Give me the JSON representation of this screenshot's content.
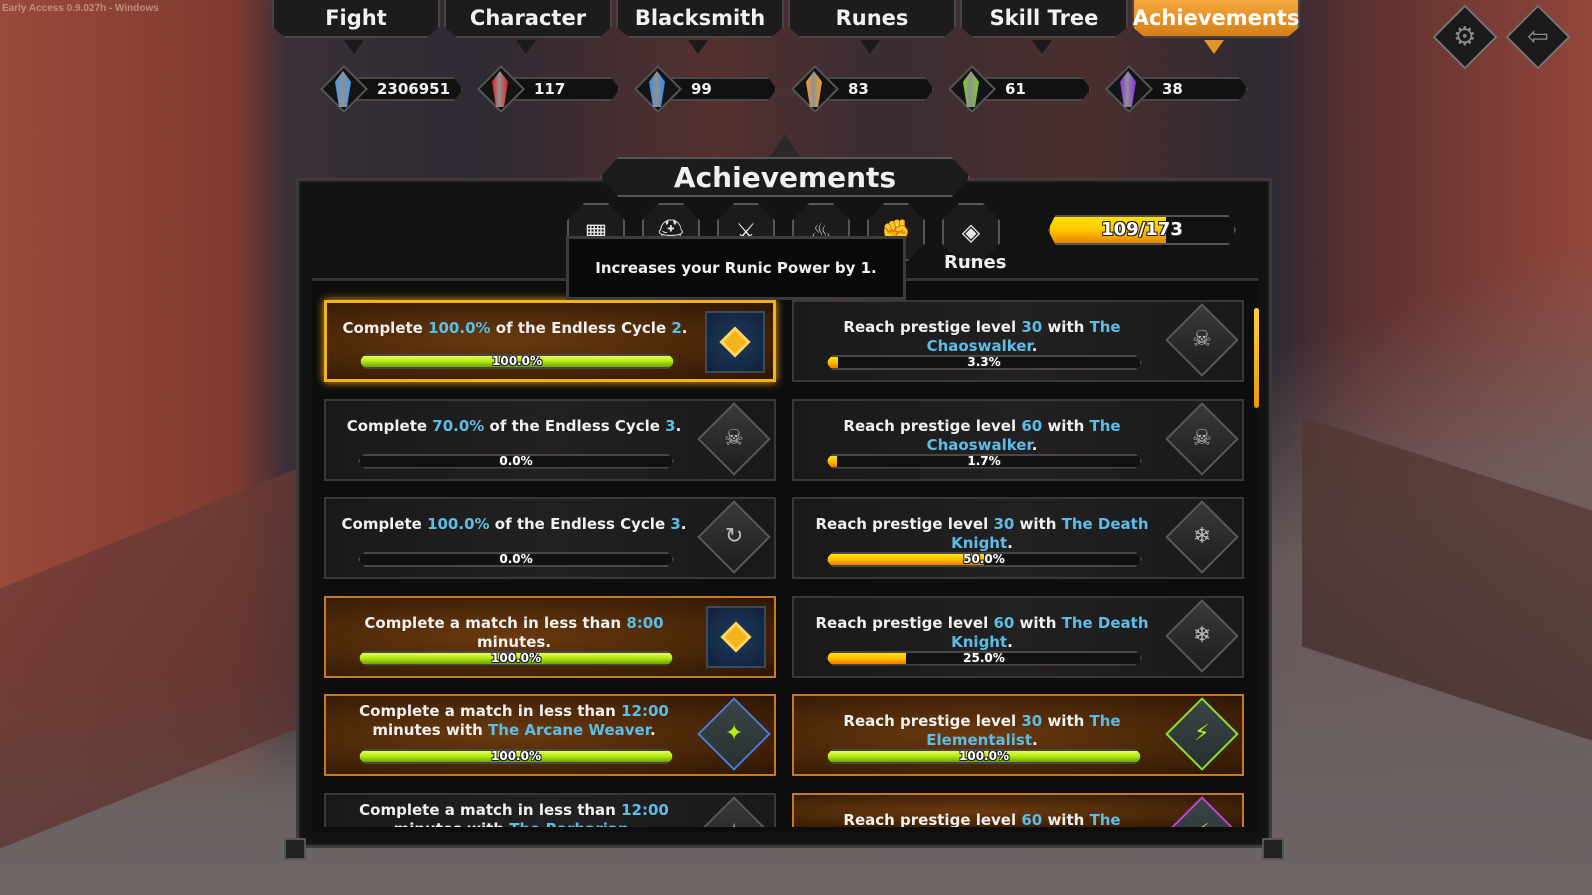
{
  "version_label": "Early Access 0.9.027h - Windows",
  "nav": {
    "tabs": [
      {
        "label": "Fight",
        "active": false
      },
      {
        "label": "Character",
        "active": false
      },
      {
        "label": "Blacksmith",
        "active": false
      },
      {
        "label": "Runes",
        "active": false
      },
      {
        "label": "Skill Tree",
        "active": false
      },
      {
        "label": "Achievements",
        "active": true
      }
    ],
    "settings_icon": "gear-icon",
    "exit_icon": "exit-door-icon"
  },
  "currencies": [
    {
      "name": "blue-crystal",
      "value": "2306951",
      "color": "#3d9cf0"
    },
    {
      "name": "red-gem",
      "value": "117",
      "color": "#e02424"
    },
    {
      "name": "blue-gem",
      "value": "99",
      "color": "#2a8cf0"
    },
    {
      "name": "orange-gem",
      "value": "83",
      "color": "#f5a020"
    },
    {
      "name": "green-gem",
      "value": "61",
      "color": "#7ad21a"
    },
    {
      "name": "purple-gem",
      "value": "38",
      "color": "#8a2cf0"
    }
  ],
  "panel": {
    "title": "Achievements",
    "categories": [
      {
        "icon": "grid-icon",
        "glyph": "▦"
      },
      {
        "icon": "helmet-icon",
        "glyph": "⛑"
      },
      {
        "icon": "sword-icon",
        "glyph": "⚔"
      },
      {
        "icon": "flame-icon",
        "glyph": "♨"
      },
      {
        "icon": "fist-icon",
        "glyph": "✊"
      },
      {
        "icon": "rune-icon",
        "glyph": "◈",
        "label": "Runes",
        "selected": true
      }
    ],
    "total_progress": {
      "text": "109/173",
      "completed": 109,
      "total": 173
    },
    "tooltip": "Increases your Runic Power by 1.",
    "scroll_position": 0.0
  },
  "achievements_left": [
    {
      "parts": [
        "Complete ",
        "100.0%",
        " of the Endless Cycle ",
        "2",
        "."
      ],
      "progress": 100.0,
      "progress_text": "100.0%",
      "done": true,
      "selected": true,
      "icon": "rune-diamond-icon"
    },
    {
      "parts": [
        "Complete ",
        "70.0%",
        " of the Endless Cycle ",
        "3",
        "."
      ],
      "progress": 0.0,
      "progress_text": "0.0%",
      "done": false,
      "icon": "chaos-skull-icon"
    },
    {
      "parts": [
        "Complete ",
        "100.0%",
        " of the Endless Cycle ",
        "3",
        "."
      ],
      "progress": 0.0,
      "progress_text": "0.0%",
      "done": false,
      "icon": "cycle-icon"
    },
    {
      "parts": [
        "Complete a match in less than ",
        "8:00",
        " minutes."
      ],
      "progress": 100.0,
      "progress_text": "100.0%",
      "done": true,
      "icon": "rune-diamond-icon"
    },
    {
      "parts": [
        "Complete a match in less than ",
        "12:00",
        " minutes with ",
        "The Arcane Weaver",
        "."
      ],
      "progress": 100.0,
      "progress_text": "100.0%",
      "done": true,
      "icon": "arcane-star-icon"
    },
    {
      "parts": [
        "Complete a match in less than ",
        "12:00",
        " minutes with ",
        "The Barbarian",
        "."
      ],
      "progress": null,
      "progress_text": "",
      "done": false,
      "icon": "barbarian-icon"
    }
  ],
  "achievements_right": [
    {
      "parts": [
        "Reach prestige level ",
        "30",
        " with ",
        "The Chaoswalker",
        "."
      ],
      "progress": 3.3,
      "progress_text": "3.3%",
      "done": false,
      "icon": "chaos-skull-book-icon"
    },
    {
      "parts": [
        "Reach prestige level ",
        "60",
        " with ",
        "The Chaoswalker",
        "."
      ],
      "progress": 1.7,
      "progress_text": "1.7%",
      "done": false,
      "icon": "chaos-skull-hex-icon"
    },
    {
      "parts": [
        "Reach prestige level ",
        "30",
        " with ",
        "The Death Knight",
        "."
      ],
      "progress": 50.0,
      "progress_text": "50.0%",
      "done": false,
      "icon": "snowflake-book-icon"
    },
    {
      "parts": [
        "Reach prestige level ",
        "60",
        " with ",
        "The Death Knight",
        "."
      ],
      "progress": 25.0,
      "progress_text": "25.0%",
      "done": false,
      "icon": "snowflake-hex-icon"
    },
    {
      "parts": [
        "Reach prestige level ",
        "30",
        " with ",
        "The Elementalist",
        "."
      ],
      "progress": 100.0,
      "progress_text": "100.0%",
      "done": true,
      "icon": "lightning-book-icon"
    },
    {
      "parts": [
        "Reach prestige level ",
        "60",
        " with ",
        "The Elementalist",
        "."
      ],
      "progress": null,
      "progress_text": "",
      "done": true,
      "icon": "lightning-hex-icon"
    }
  ]
}
